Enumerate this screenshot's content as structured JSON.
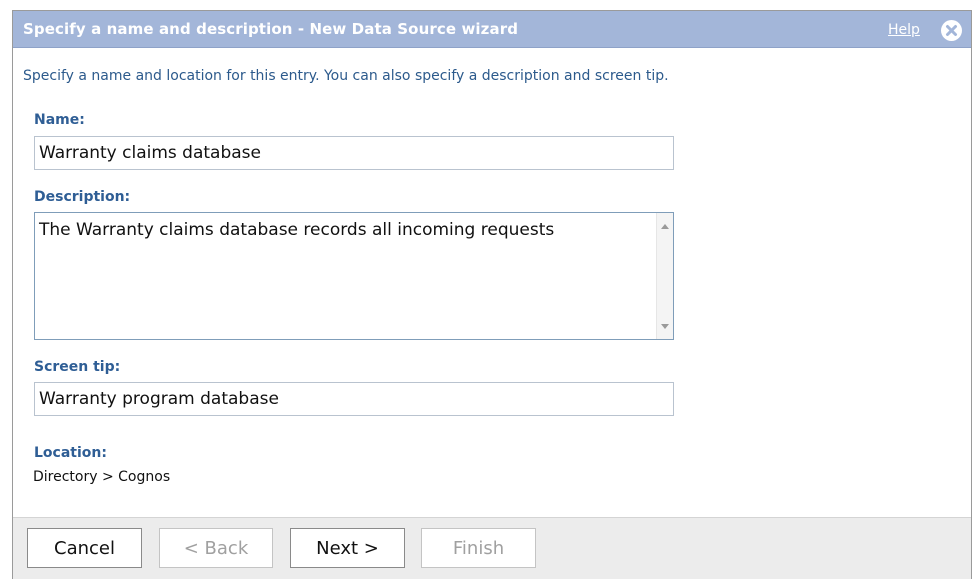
{
  "dialog": {
    "title": "Specify a name and description - New Data Source wizard",
    "help_label": "Help",
    "close_icon": "close-icon",
    "colors": {
      "titlebar": "#a3b6d9",
      "label": "#2f5e95",
      "intro": "#2c5a8c"
    }
  },
  "intro_text": "Specify a name and location for this entry. You can also specify a description and screen tip.",
  "fields": {
    "name": {
      "label": "Name:",
      "value": "Warranty claims database"
    },
    "description": {
      "label": "Description:",
      "value": "The Warranty claims database records all incoming requests"
    },
    "screen_tip": {
      "label": "Screen tip:",
      "value": "Warranty program database"
    },
    "location": {
      "label": "Location:",
      "value": "Directory > Cognos"
    }
  },
  "buttons": {
    "cancel": "Cancel",
    "back": "< Back",
    "next": "Next >",
    "finish": "Finish"
  }
}
